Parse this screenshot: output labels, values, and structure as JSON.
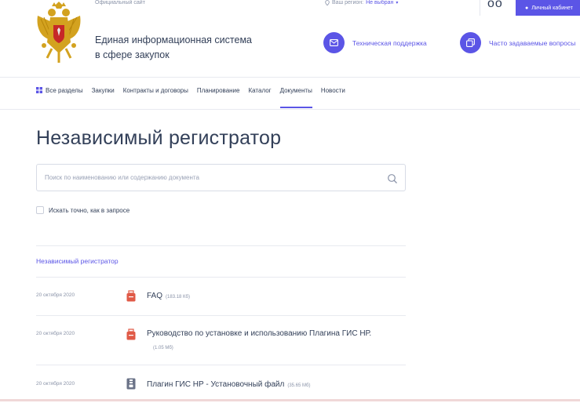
{
  "top": {
    "official": "Официальный сайт",
    "region_label": "Ваш регион:",
    "region_value": "Не выбран",
    "login": "Личный кабинет"
  },
  "header": {
    "title_line1": "Единая информационная система",
    "title_line2": "в сфере закупок",
    "support": "Техническая поддержка",
    "faq": "Часто задаваемые вопросы"
  },
  "nav": {
    "items": [
      {
        "label": "Все разделы"
      },
      {
        "label": "Закупки"
      },
      {
        "label": "Контракты и договоры"
      },
      {
        "label": "Планирование"
      },
      {
        "label": "Каталог"
      },
      {
        "label": "Документы"
      },
      {
        "label": "Новости"
      }
    ]
  },
  "page": {
    "title": "Независимый регистратор",
    "search_placeholder": "Поиск по наименованию или содержанию документа",
    "exact_label": "Искать точно, как в запросе",
    "section": "Независимый регистратор"
  },
  "documents": [
    {
      "date": "20 октября 2020",
      "name": "FAQ",
      "size": "(183.18 Кб)",
      "icon": "pdf-icon"
    },
    {
      "date": "20 октября 2020",
      "name": "Руководство по установке и использованию Плагина ГИС НР.",
      "size": "(1.05 Мб)",
      "icon": "pdf-icon"
    },
    {
      "date": "20 октября 2020",
      "name": "Плагин ГИС НР - Установочный файл",
      "size": "(35.65 Мб)",
      "icon": "archive-icon"
    }
  ],
  "colors": {
    "accent": "#5b55e6",
    "text": "#334059",
    "muted": "#8a93a8",
    "pdf": "#e05a47"
  }
}
